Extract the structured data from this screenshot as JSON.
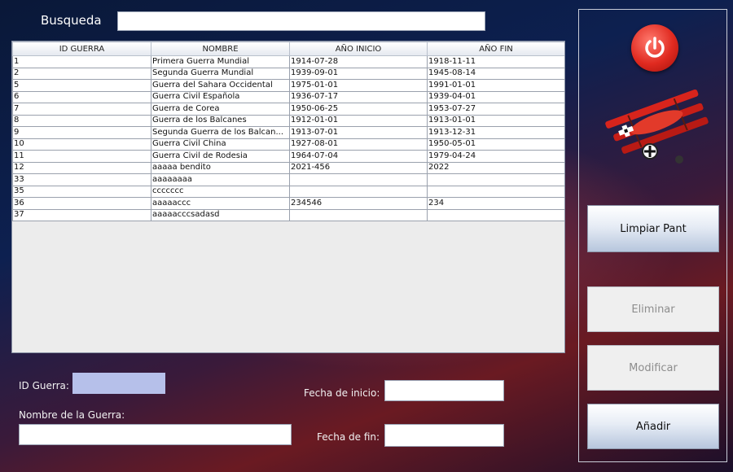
{
  "search": {
    "label": "Busqueda",
    "value": ""
  },
  "table": {
    "headers": [
      "ID GUERRA",
      "NOMBRE",
      "AÑO INICIO",
      "AÑO FIN"
    ],
    "rows": [
      [
        "1",
        "Primera Guerra Mundial",
        "1914-07-28",
        "1918-11-11"
      ],
      [
        "2",
        "Segunda Guerra Mundial",
        "1939-09-01",
        "1945-08-14"
      ],
      [
        "5",
        "Guerra del Sahara Occidental",
        "1975-01-01",
        "1991-01-01"
      ],
      [
        "6",
        "Guerra Civil Española",
        "1936-07-17",
        "1939-04-01"
      ],
      [
        "7",
        "Guerra de Corea",
        "1950-06-25",
        "1953-07-27"
      ],
      [
        "8",
        "Guerra de los Balcanes",
        "1912-01-01",
        "1913-01-01"
      ],
      [
        "9",
        "Segunda Guerra de los Balcan...",
        "1913-07-01",
        "1913-12-31"
      ],
      [
        "10",
        "Guerra Civil China",
        "1927-08-01",
        "1950-05-01"
      ],
      [
        "11",
        "Guerra Civil de Rodesia",
        "1964-07-04",
        "1979-04-24"
      ],
      [
        "12",
        "aaaaa bendito",
        "2021-456",
        "2022"
      ],
      [
        "33",
        "aaaaaaaa",
        "",
        ""
      ],
      [
        "35",
        "ccccccc",
        "",
        ""
      ],
      [
        "36",
        "aaaaaccc",
        "234546",
        "234"
      ],
      [
        "37",
        "aaaaacccsadasd",
        "",
        ""
      ]
    ]
  },
  "side_panel": {
    "power_icon": "power-icon",
    "illustration": "triplane-illustration",
    "clear_label": "Limpiar Pant",
    "delete_label": "Eliminar",
    "modify_label": "Modificar",
    "add_label": "Añadir"
  },
  "form": {
    "id_label": "ID Guerra:",
    "id_value": "",
    "name_label": "Nombre de la Guerra:",
    "name_value": "",
    "start_label": "Fecha de inicio:",
    "start_value": "",
    "end_label": "Fecha de fin:",
    "end_value": ""
  },
  "colors": {
    "accent": "#e02a20",
    "id_field_bg": "#b6c0ea"
  }
}
